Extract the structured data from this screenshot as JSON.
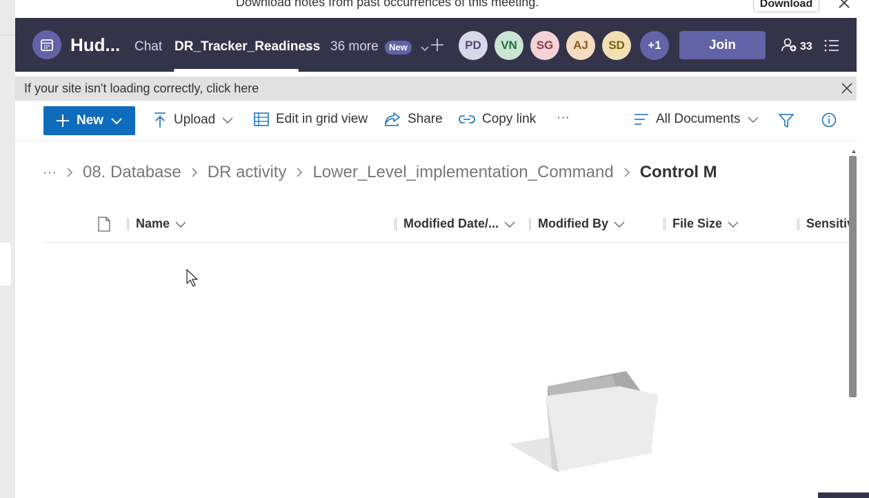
{
  "banner": {
    "text": "Download notes from past occurrences of this meeting.",
    "button_label": "Download"
  },
  "meeting": {
    "title": "Hud...",
    "tabs": [
      {
        "label": "Chat",
        "active": false
      },
      {
        "label": "DR_Tracker_Readiness",
        "active": true
      },
      {
        "label": "36 more",
        "active": false
      }
    ],
    "new_badge": "New",
    "participants": [
      {
        "initials": "PD",
        "bg": "#d8d8e8",
        "fg": "#4b4b73"
      },
      {
        "initials": "VN",
        "bg": "#c8e6d2",
        "fg": "#2c6b43"
      },
      {
        "initials": "SG",
        "bg": "#f3d3d8",
        "fg": "#8e3a4a"
      },
      {
        "initials": "AJ",
        "bg": "#f5dcc0",
        "fg": "#8a5a22"
      },
      {
        "initials": "SD",
        "bg": "#f2e0b5",
        "fg": "#7c5d12"
      },
      {
        "initials": "+1",
        "bg": "#6264a7",
        "fg": "#ffffff"
      }
    ],
    "join_label": "Join",
    "people_count": "33",
    "accent": "#6264a7",
    "bar_color": "#33344a"
  },
  "notice": {
    "text": "If your site isn't loading correctly, click here"
  },
  "commands": {
    "new_label": "New",
    "upload_label": "Upload",
    "grid_label": "Edit in grid view",
    "share_label": "Share",
    "copy_label": "Copy link",
    "more_label": "···",
    "view_label": "All Documents",
    "brand_blue": "#0f6cbd"
  },
  "breadcrumb": {
    "overflow": "···",
    "items": [
      "08. Database",
      "DR activity",
      "Lower_Level_implementation_Command",
      "Control M"
    ]
  },
  "columns": {
    "name": "Name",
    "modified": "Modified Date/...",
    "modified_by": "Modified By",
    "file_size": "File Size",
    "sensitivity": "Sensitiv"
  }
}
